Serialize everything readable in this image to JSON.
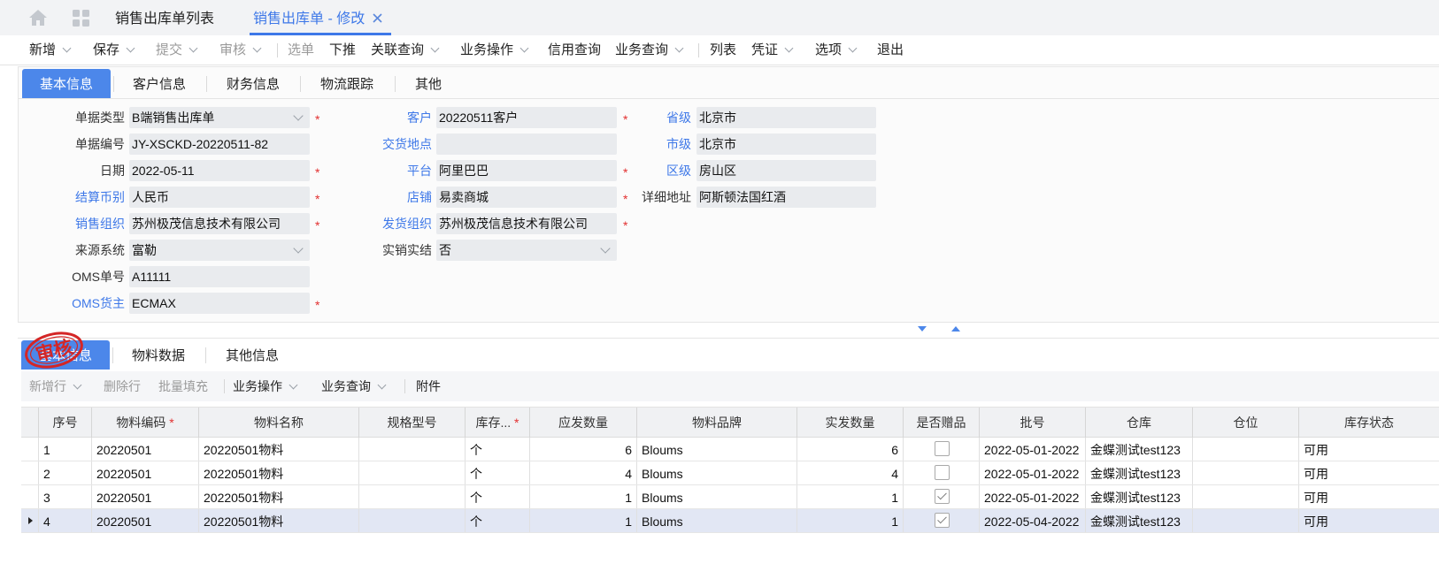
{
  "app_tabs": [
    {
      "label": "销售出库单列表",
      "active": false
    },
    {
      "label": "销售出库单 - 修改",
      "active": true
    }
  ],
  "icons": {
    "home": "home-icon",
    "apps": "apps-grid-icon",
    "close": "close-icon"
  },
  "toolbar": [
    {
      "label": "新增",
      "dropdown": true,
      "disabled": false
    },
    {
      "label": "保存",
      "dropdown": true,
      "disabled": false
    },
    {
      "label": "提交",
      "dropdown": true,
      "disabled": true
    },
    {
      "label": "审核",
      "dropdown": true,
      "disabled": true
    },
    {
      "label": "选单",
      "dropdown": false,
      "disabled": true
    },
    {
      "label": "下推",
      "dropdown": false,
      "disabled": false
    },
    {
      "label": "关联查询",
      "dropdown": true,
      "disabled": false
    },
    {
      "label": "业务操作",
      "dropdown": true,
      "disabled": false
    },
    {
      "label": "信用查询",
      "dropdown": false,
      "disabled": false
    },
    {
      "label": "业务查询",
      "dropdown": true,
      "disabled": false
    },
    {
      "label": "列表",
      "dropdown": false,
      "disabled": false
    },
    {
      "label": "凭证",
      "dropdown": true,
      "disabled": false
    },
    {
      "label": "选项",
      "dropdown": true,
      "disabled": false
    },
    {
      "label": "退出",
      "dropdown": false,
      "disabled": false
    }
  ],
  "header_tabs": [
    "基本信息",
    "客户信息",
    "财务信息",
    "物流跟踪",
    "其他"
  ],
  "form": {
    "col1": [
      {
        "label": "单据类型",
        "value": "B端销售出库单",
        "blue": false,
        "required": true,
        "dropdown": true
      },
      {
        "label": "单据编号",
        "value": "JY-XSCKD-20220511-82",
        "blue": false,
        "required": false,
        "dropdown": false
      },
      {
        "label": "日期",
        "value": "2022-05-11",
        "blue": false,
        "required": true,
        "dropdown": false
      },
      {
        "label": "结算币别",
        "value": "人民币",
        "blue": true,
        "required": true,
        "dropdown": false
      },
      {
        "label": "销售组织",
        "value": "苏州极茂信息技术有限公司",
        "blue": true,
        "required": true,
        "dropdown": false
      },
      {
        "label": "来源系统",
        "value": "富勒",
        "blue": false,
        "required": false,
        "dropdown": true
      },
      {
        "label": "OMS单号",
        "value": "A11111",
        "blue": false,
        "required": false,
        "dropdown": false
      },
      {
        "label": "OMS货主",
        "value": "ECMAX",
        "blue": true,
        "required": true,
        "dropdown": false
      }
    ],
    "col2": [
      {
        "label": "客户",
        "value": "20220511客户",
        "blue": true,
        "required": true,
        "dropdown": false
      },
      {
        "label": "交货地点",
        "value": "",
        "blue": true,
        "required": false,
        "dropdown": false
      },
      {
        "label": "平台",
        "value": "阿里巴巴",
        "blue": true,
        "required": true,
        "dropdown": false
      },
      {
        "label": "店铺",
        "value": "易卖商城",
        "blue": true,
        "required": true,
        "dropdown": false
      },
      {
        "label": "发货组织",
        "value": "苏州极茂信息技术有限公司",
        "blue": true,
        "required": true,
        "dropdown": false
      },
      {
        "label": "实销实结",
        "value": "否",
        "blue": false,
        "required": false,
        "dropdown": true
      }
    ],
    "col3": [
      {
        "label": "省级",
        "value": "北京市",
        "blue": true
      },
      {
        "label": "市级",
        "value": "北京市",
        "blue": true
      },
      {
        "label": "区级",
        "value": "房山区",
        "blue": true
      },
      {
        "label": "详细地址",
        "value": "阿斯顿法国红酒",
        "blue": false
      }
    ]
  },
  "detail_tabs": [
    "基本信息",
    "物料数据",
    "其他信息"
  ],
  "stamp_text": "审核",
  "detail_toolbar": [
    {
      "label": "新增行",
      "dropdown": true,
      "disabled": true
    },
    {
      "label": "删除行",
      "dropdown": false,
      "disabled": true
    },
    {
      "label": "批量填充",
      "dropdown": false,
      "disabled": true
    },
    {
      "label": "业务操作",
      "dropdown": true,
      "disabled": false
    },
    {
      "label": "业务查询",
      "dropdown": true,
      "disabled": false
    },
    {
      "label": "附件",
      "dropdown": false,
      "disabled": false
    }
  ],
  "grid": {
    "columns": [
      "序号",
      "物料编码",
      "物料名称",
      "规格型号",
      "库存...",
      "应发数量",
      "物料品牌",
      "实发数量",
      "是否赠品",
      "批号",
      "仓库",
      "仓位",
      "库存状态"
    ],
    "required_columns": [
      1,
      4
    ],
    "rows": [
      {
        "no": "1",
        "code": "20220501",
        "name": "20220501物料",
        "spec": "",
        "unit": "个",
        "due": "6",
        "brand": "Bloums",
        "actual": "6",
        "gift": false,
        "batch": "2022-05-01-2022",
        "wh": "金蝶测试test123",
        "loc": "",
        "status": "可用"
      },
      {
        "no": "2",
        "code": "20220501",
        "name": "20220501物料",
        "spec": "",
        "unit": "个",
        "due": "4",
        "brand": "Bloums",
        "actual": "4",
        "gift": false,
        "batch": "2022-05-01-2022",
        "wh": "金蝶测试test123",
        "loc": "",
        "status": "可用"
      },
      {
        "no": "3",
        "code": "20220501",
        "name": "20220501物料",
        "spec": "",
        "unit": "个",
        "due": "1",
        "brand": "Bloums",
        "actual": "1",
        "gift": true,
        "batch": "2022-05-01-2022",
        "wh": "金蝶测试test123",
        "loc": "",
        "status": "可用"
      },
      {
        "no": "4",
        "code": "20220501",
        "name": "20220501物料",
        "spec": "",
        "unit": "个",
        "due": "1",
        "brand": "Bloums",
        "actual": "1",
        "gift": true,
        "batch": "2022-05-04-2022",
        "wh": "金蝶测试test123",
        "loc": "",
        "status": "可用"
      }
    ],
    "selected_row": 3
  }
}
